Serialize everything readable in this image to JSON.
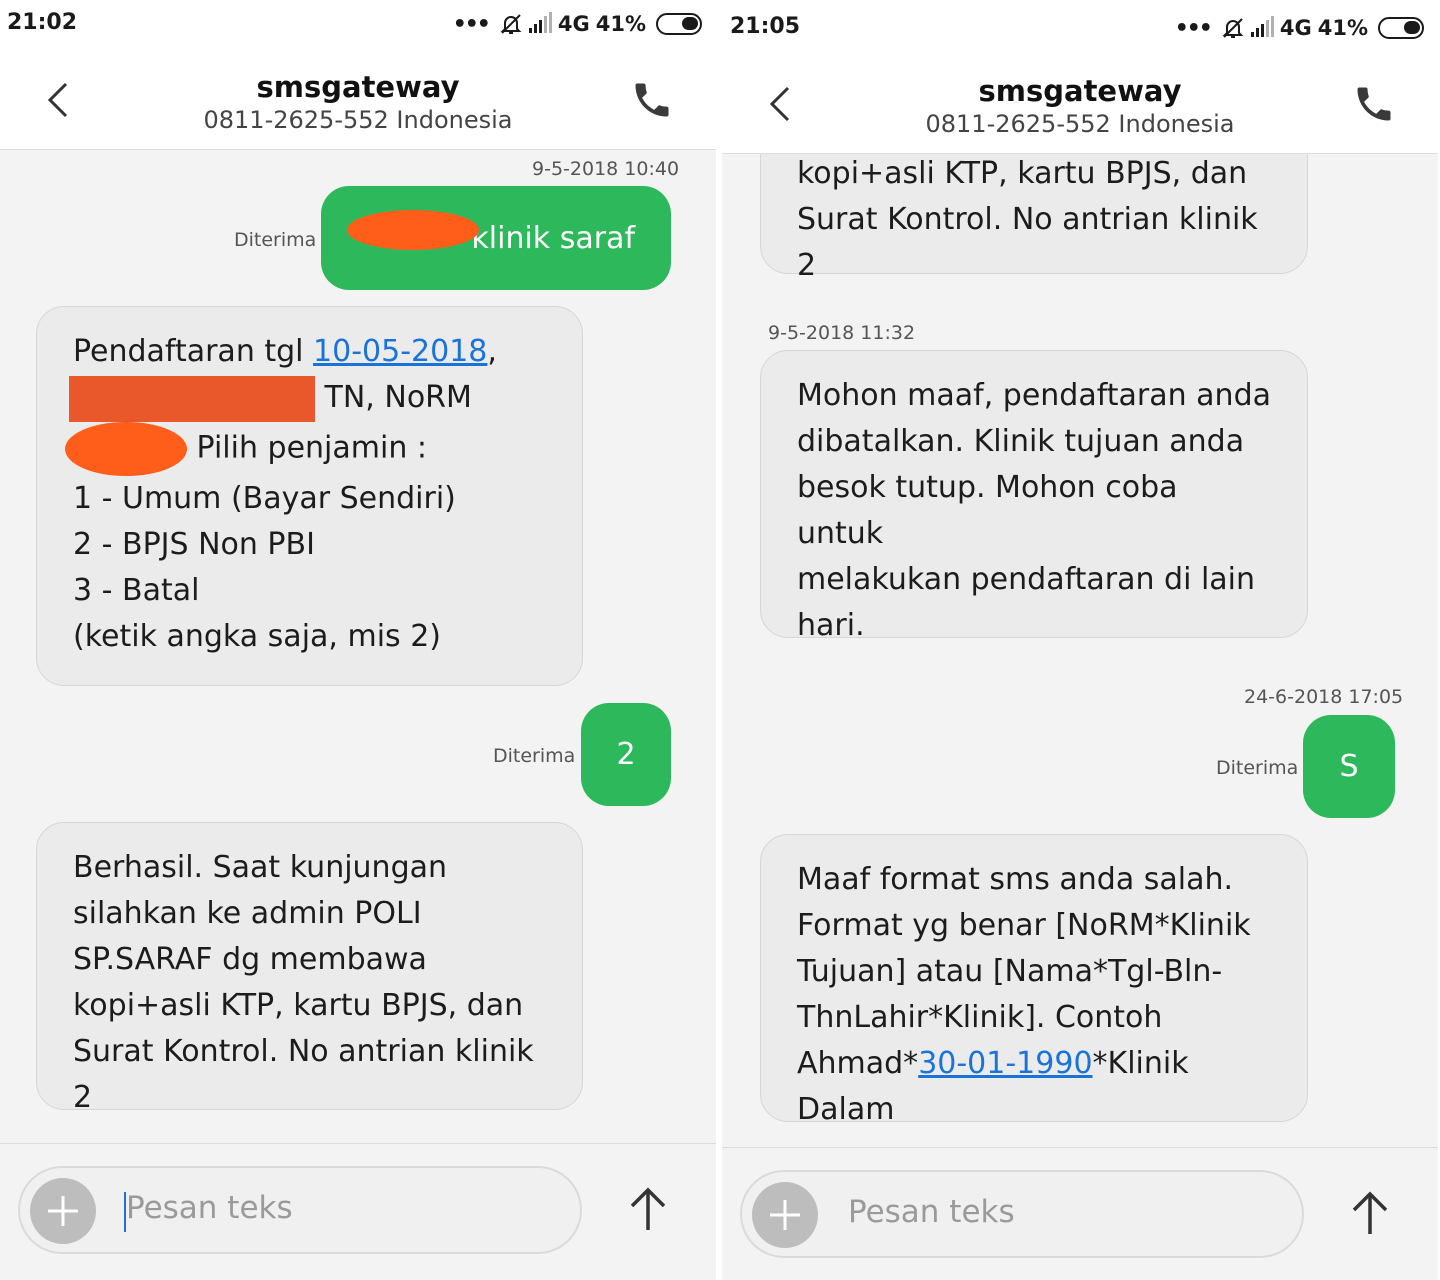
{
  "left": {
    "status": {
      "time": "21:02",
      "network": "4G",
      "battery": "41%"
    },
    "header": {
      "title": "smsgateway",
      "subtitle": "0811-2625-552 Indonesia"
    },
    "messages": {
      "ts1": "9-5-2018 10:40",
      "out1": {
        "text": "klinik saraf",
        "status": "Diterima"
      },
      "in1": {
        "l1_pre": "Pendaftaran tgl ",
        "l1_link": "10-05-2018",
        "l1_post": ",",
        "l2": " TN, NoRM",
        "l3": " Pilih penjamin :",
        "l4": "1 - Umum (Bayar Sendiri)",
        "l5": "2 - BPJS Non PBI",
        "l6": "3 - Batal",
        "l7": "(ketik angka saja, mis 2)"
      },
      "out2": {
        "text": "2",
        "status": "Diterima"
      },
      "in2": {
        "l1": "Berhasil. Saat kunjungan",
        "l2": "silahkan ke admin POLI",
        "l3": "SP.SARAF dg membawa",
        "l4": "kopi+asli KTP, kartu BPJS, dan",
        "l5": "Surat Kontrol. No antrian klinik 2"
      }
    },
    "composer": {
      "placeholder": "Pesan teks"
    }
  },
  "right": {
    "status": {
      "time": "21:05",
      "network": "4G",
      "battery": "41%"
    },
    "header": {
      "title": "smsgateway",
      "subtitle": "0811-2625-552 Indonesia"
    },
    "messages": {
      "in0": {
        "l1": "kopi+asli KTP, kartu BPJS, dan",
        "l2": "Surat Kontrol. No antrian klinik 2"
      },
      "ts1": "9-5-2018 11:32",
      "in1": {
        "l1": "Mohon maaf, pendaftaran anda",
        "l2": "dibatalkan. Klinik tujuan anda",
        "l3": "besok tutup. Mohon coba untuk",
        "l4": "melakukan pendaftaran di lain",
        "l5": "hari."
      },
      "ts2": "24-6-2018 17:05",
      "out1": {
        "text": "S",
        "status": "Diterima"
      },
      "in2": {
        "l1": "Maaf format sms anda salah.",
        "l2": "Format yg benar [NoRM*Klinik",
        "l3": "Tujuan] atau [Nama*Tgl-Bln-",
        "l4": "ThnLahir*Klinik]. Contoh",
        "l5_pre": "Ahmad*",
        "l5_link": "30-01-1990",
        "l5_post": "*Klinik Dalam"
      }
    },
    "composer": {
      "placeholder": "Pesan teks"
    }
  },
  "icons": [
    "back-arrow-icon",
    "phone-icon",
    "plus-icon",
    "send-arrow-icon",
    "mute-bell-icon",
    "signal-icon",
    "battery-icon"
  ],
  "colors": {
    "outgoing_bubble": "#2eb85c",
    "incoming_bubble": "#ebebeb",
    "link": "#1a73d9",
    "redaction": "#fe5d1a"
  }
}
